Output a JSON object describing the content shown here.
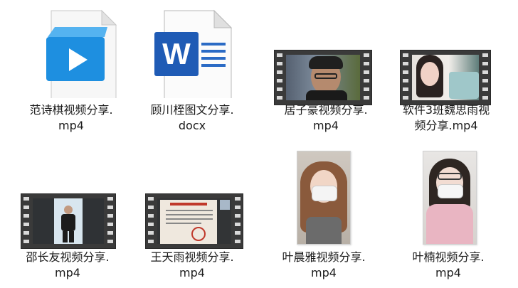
{
  "files": [
    {
      "name_line1": "范诗棋视频分享.",
      "name_line2": "mp4",
      "icon": "video-player-icon",
      "type": "mp4"
    },
    {
      "name_line1": "顾川桎图文分享.",
      "name_line2": "docx",
      "icon": "word-document-icon",
      "type": "docx"
    },
    {
      "name_line1": "居子豪视频分享.",
      "name_line2": "mp4",
      "icon": "video-thumbnail",
      "type": "mp4"
    },
    {
      "name_line1": "软件3班魏思雨视",
      "name_line2": "频分享.mp4",
      "icon": "video-thumbnail",
      "type": "mp4"
    },
    {
      "name_line1": "邵长友视频分享.",
      "name_line2": "mp4",
      "icon": "video-thumbnail",
      "type": "mp4"
    },
    {
      "name_line1": "王天雨视频分享.",
      "name_line2": "mp4",
      "icon": "video-thumbnail",
      "type": "mp4"
    },
    {
      "name_line1": "叶晨雅视频分享.",
      "name_line2": "mp4",
      "icon": "video-thumbnail",
      "type": "mp4"
    },
    {
      "name_line1": "叶楠视频分享.",
      "name_line2": "mp4",
      "icon": "video-thumbnail",
      "type": "mp4"
    }
  ],
  "word_icon_letter": "W",
  "colors": {
    "video_icon_blue": "#1e8fe0",
    "word_blue": "#1f5bb5",
    "film_strip": "#3a3a3a"
  }
}
